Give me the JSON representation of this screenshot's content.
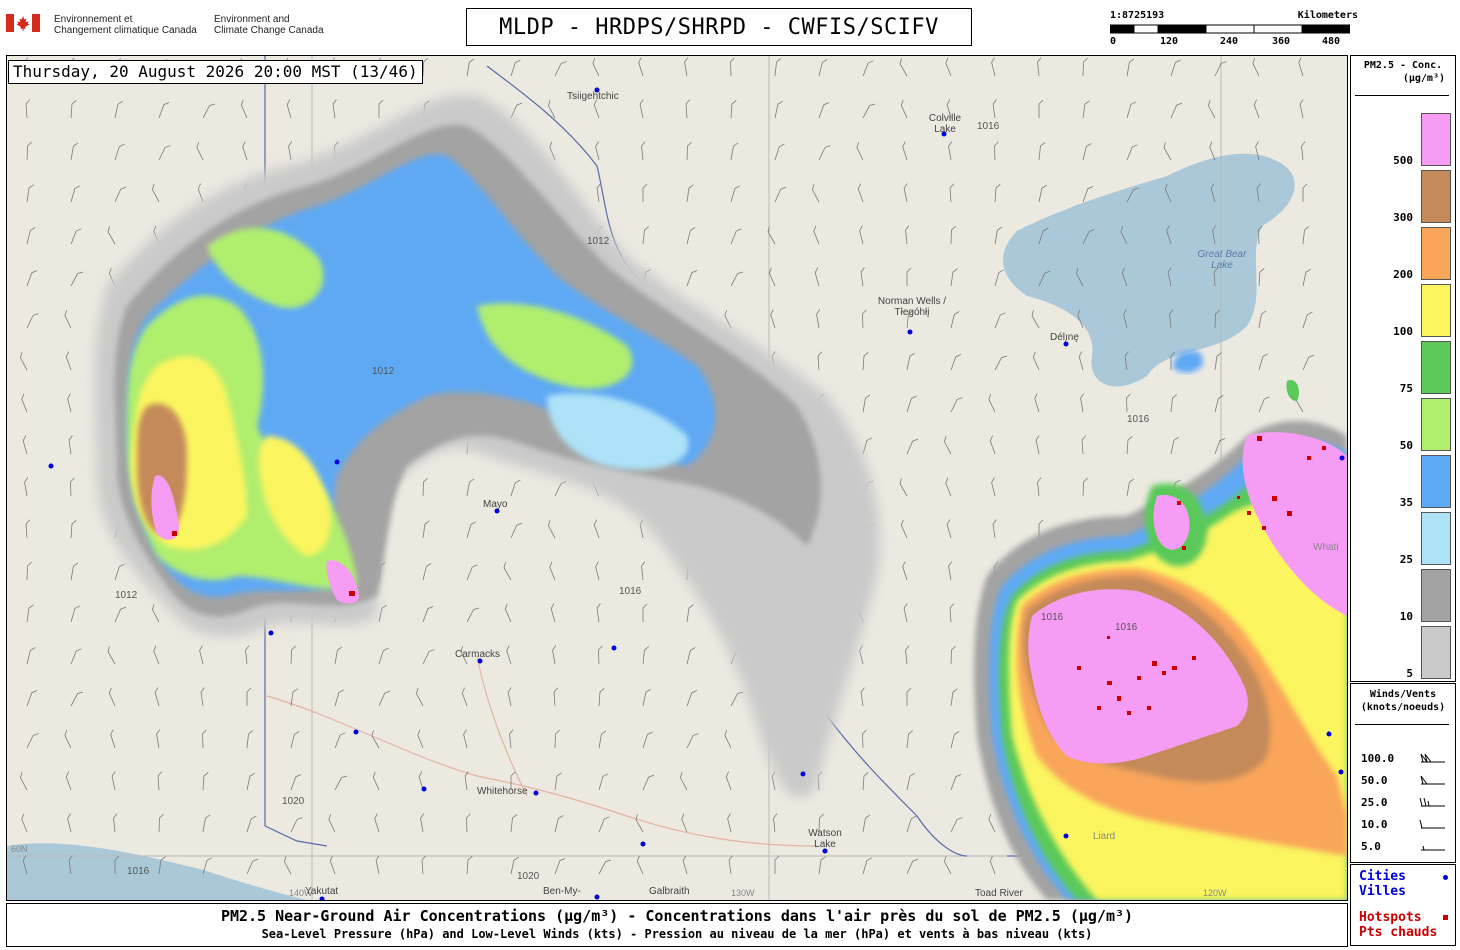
{
  "header": {
    "agency_fr": [
      "Environnement et",
      "Changement climatique Canada"
    ],
    "agency_en": [
      "Environment and",
      "Climate Change Canada"
    ],
    "title": "MLDP - HRDPS/SHRPD - CWFIS/SCIFV"
  },
  "scale": {
    "ratio": "1:8725193",
    "unit": "Kilometers",
    "ticks": [
      "0",
      "120",
      "240",
      "360",
      "480"
    ]
  },
  "timestamp": "Thursday, 20 August 2026 20:00 MST (13/46)",
  "legend": {
    "title_line1": "PM2.5 - Conc.",
    "title_line2": "(µg/m³)",
    "bins": [
      {
        "label": "500",
        "color": "#f79cf5"
      },
      {
        "label": "300",
        "color": "#c58a5a"
      },
      {
        "label": "200",
        "color": "#f9a55a"
      },
      {
        "label": "100",
        "color": "#fbf55e"
      },
      {
        "label": "75",
        "color": "#5ac95a"
      },
      {
        "label": "50",
        "color": "#b0ee6e"
      },
      {
        "label": "35",
        "color": "#5ea9f4"
      },
      {
        "label": "25",
        "color": "#aee2f7"
      },
      {
        "label": "10",
        "color": "#a3a3a3"
      },
      {
        "label": "5",
        "color": "#cacaca"
      }
    ]
  },
  "winds_legend": {
    "title_line1": "Winds/Vents",
    "title_line2": "(knots/noeuds)",
    "rows": [
      "100.0",
      "50.0",
      "25.0",
      "10.0",
      "5.0"
    ]
  },
  "markers_legend": {
    "cities_en": "Cities",
    "cities_fr": "Villes",
    "hotspots_en": "Hotspots",
    "hotspots_fr": "Pts chauds",
    "city_color": "#0000dd",
    "hotspot_color": "#cc0000"
  },
  "footer": {
    "line1": "PM2.5 Near-Ground Air Concentrations (µg/m³) - Concentrations dans l'air près du sol de PM2.5 (µg/m³)",
    "line2": "Sea-Level Pressure (hPa) and Low-Level Winds (kts) - Pression au niveau de la mer (hPa) et vents à bas niveau (kts)"
  },
  "map_labels": {
    "places": [
      "Tsiigehtchic",
      "Colville Lake",
      "Norman Wells / Tłegóhłį",
      "Délı̨nę",
      "Great Bear Lake",
      "Mayo",
      "Carmacks",
      "Whitehorse",
      "Watson Lake",
      "Yakutat",
      "Ben-My-",
      "Galbraith",
      "Toad River",
      "Whati",
      "Liard"
    ],
    "isobars": [
      "1012",
      "1016",
      "1020"
    ],
    "meridians": [
      "140W",
      "130W",
      "120W",
      "60N"
    ]
  }
}
